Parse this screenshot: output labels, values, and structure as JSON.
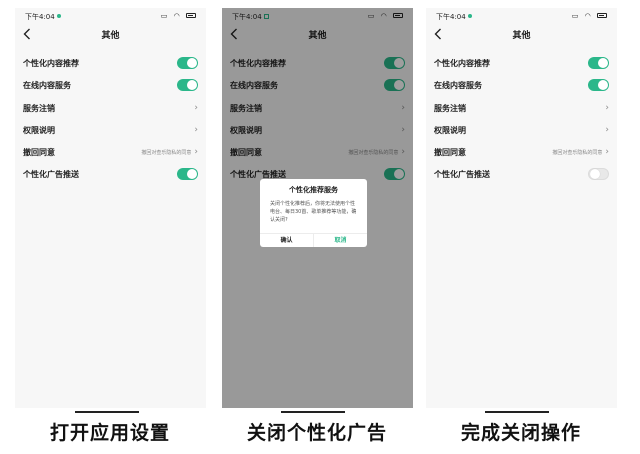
{
  "colors": {
    "accent": "#2bb78a",
    "text": "#222222",
    "background": "#f7f7f7"
  },
  "status_time": "下午4:04",
  "nav_title": "其他",
  "settings": {
    "personalized_content": "个性化内容推荐",
    "online_content": "在线内容服务",
    "service_cancel": "服务注销",
    "permissions": "权限说明",
    "withdraw_consent": "撤回同意",
    "withdraw_hint": "撤回对查乐隐私的同意",
    "personalized_ads": "个性化广告推送"
  },
  "screens": [
    {
      "toggles": {
        "personalized_content": true,
        "online_content": true,
        "personalized_ads": true
      }
    },
    {
      "toggles": {
        "personalized_content": true,
        "online_content": true,
        "personalized_ads": true
      }
    },
    {
      "toggles": {
        "personalized_content": true,
        "online_content": true,
        "personalized_ads": false
      }
    }
  ],
  "dialog": {
    "title": "个性化推荐服务",
    "body": "关闭个性化推荐后，你将无法使用个性电台、每日30首、歌单推荐等功能，确认关闭?",
    "confirm": "确认",
    "cancel": "取消"
  },
  "captions": [
    "打开应用设置",
    "关闭个性化广告",
    "完成关闭操作"
  ]
}
